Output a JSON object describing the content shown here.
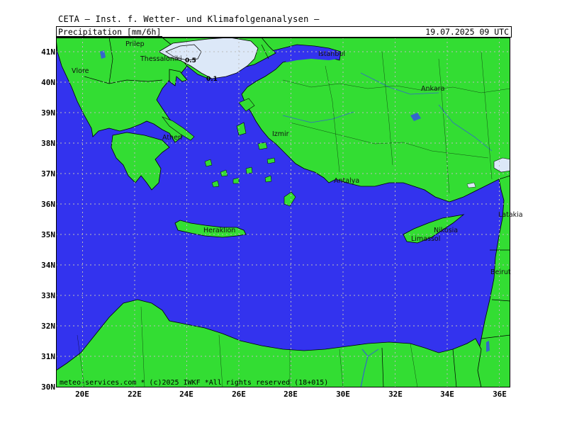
{
  "header": {
    "org": "CETA – Inst. f. Wetter- und Klimafolgenanalysen –",
    "parameter": "Precipitation [mm/6h]",
    "datetime": "19.07.2025 09 UTC"
  },
  "footer": "meteo-services.com * (c)2025 IWKF *All rights reserved (18+015)",
  "axes": {
    "lat_labels": [
      "41N",
      "40N",
      "39N",
      "38N",
      "37N",
      "36N",
      "35N",
      "34N",
      "33N",
      "32N",
      "31N",
      "30N"
    ],
    "lon_labels": [
      "20E",
      "22E",
      "24E",
      "26E",
      "28E",
      "30E",
      "32E",
      "34E",
      "36E"
    ]
  },
  "cities": {
    "prilep": "Prilep",
    "thessaloniki": "Thessaloniki",
    "vlore": "Vlore",
    "istanbul": "Istanbul",
    "ankara": "Ankara",
    "izmir": "Izmir",
    "athen": "Athen",
    "antalya": "Antalya",
    "heraklion": "Heraklion",
    "nikosia": "Nikosia",
    "limassol": "Limassol",
    "latakia": "Latakia",
    "beirut": "Beirut"
  },
  "contours": {
    "c1": "0.5",
    "c2": "0.1"
  },
  "colors": {
    "sea": "#3333ee",
    "land": "#33dd33",
    "precip_light": "#dce8f8",
    "grid": "#bbbbbb",
    "borders": "#000000",
    "rivers": "#3366cc"
  }
}
